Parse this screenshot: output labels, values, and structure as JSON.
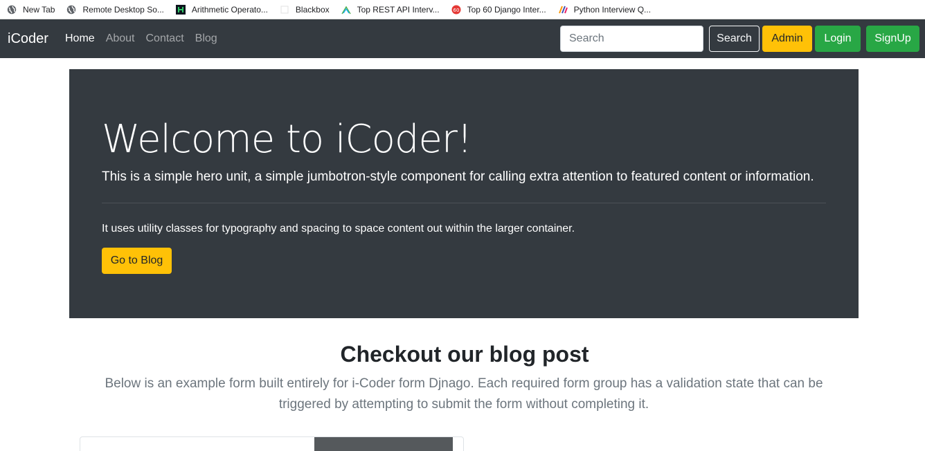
{
  "bookmarks": [
    {
      "label": "New Tab",
      "icon": "globe-icon"
    },
    {
      "label": "Remote Desktop So...",
      "icon": "globe-icon"
    },
    {
      "label": "Arithmetic Operato...",
      "icon": "hackerrank-icon"
    },
    {
      "label": "Blackbox",
      "icon": "blackbox-icon"
    },
    {
      "label": "Top REST API Interv...",
      "icon": "chart-icon"
    },
    {
      "label": "Top 60 Django Inter...",
      "icon": "django-icon"
    },
    {
      "label": "Python Interview Q...",
      "icon": "python-icon"
    }
  ],
  "navbar": {
    "brand": "iCoder",
    "links": [
      "Home",
      "About",
      "Contact",
      "Blog"
    ],
    "active_link": "Home",
    "search_placeholder": "Search",
    "search_button": "Search",
    "admin_button": "Admin",
    "login_button": "Login",
    "signup_button": "SignUp"
  },
  "jumbotron": {
    "heading": "Welcome to iCoder!",
    "lead": "This is a simple hero unit, a simple jumbotron-style component for calling extra attention to featured content or information.",
    "text": "It uses utility classes for typography and spacing to space content out within the larger container.",
    "button": "Go to Blog"
  },
  "blog": {
    "title": "Checkout our blog post",
    "description": "Below is an example form built entirely for i-Coder form Djnago. Each required form group has a validation state that can be triggered by attempting to submit the form without completing it."
  },
  "colors": {
    "dark": "#343a40",
    "warning": "#ffc107",
    "success": "#28a745"
  }
}
